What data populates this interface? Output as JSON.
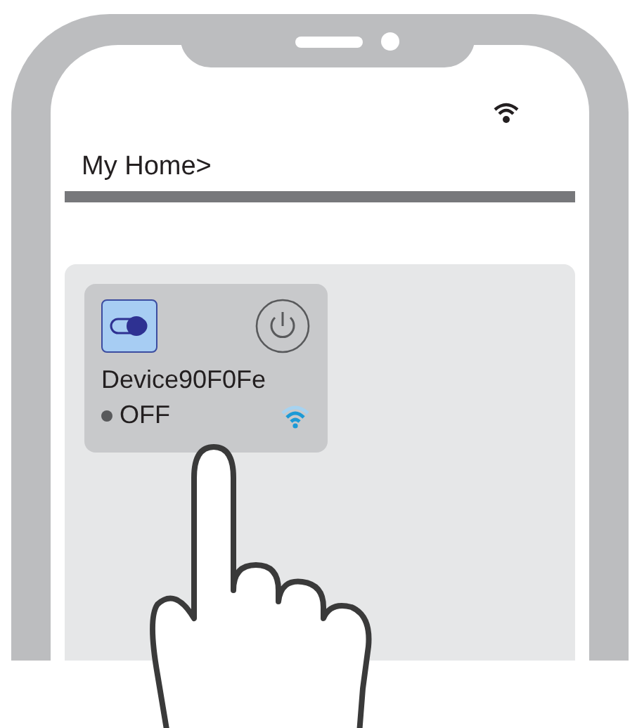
{
  "header": {
    "title": "My Home>"
  },
  "device": {
    "name": "Device90F0Fe",
    "status": "OFF",
    "online": true,
    "switch_on": true
  }
}
